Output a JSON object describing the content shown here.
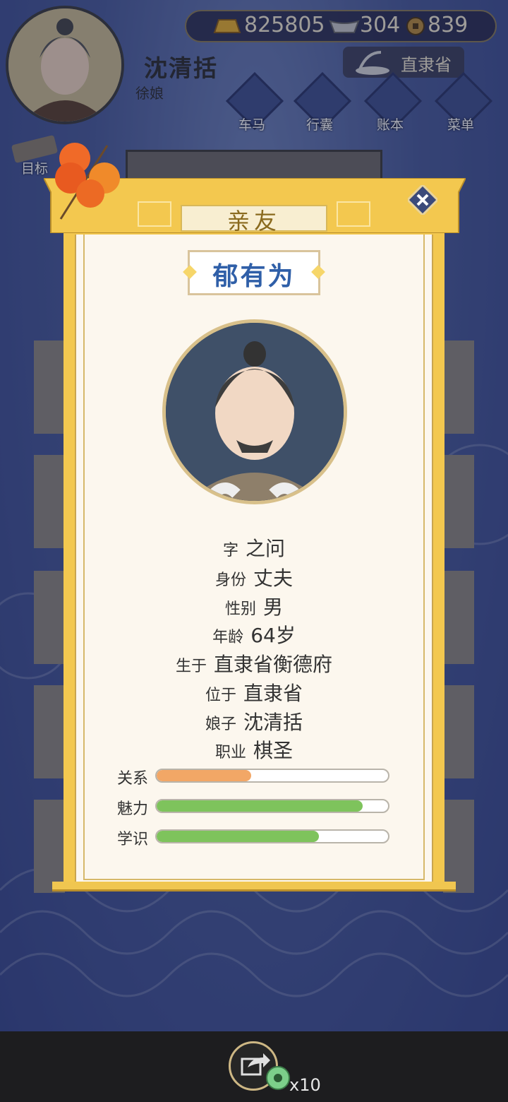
{
  "player": {
    "name": "沈清括",
    "title": "徐娘"
  },
  "resources": {
    "gold": "825805",
    "silver": "304",
    "coins": "839"
  },
  "location": {
    "province": "直隶省"
  },
  "menu": [
    {
      "label": "车马",
      "icon": "carriage-icon"
    },
    {
      "label": "行囊",
      "icon": "bag-icon"
    },
    {
      "label": "账本",
      "icon": "ledger-icon"
    },
    {
      "label": "菜单",
      "icon": "more-icon"
    }
  ],
  "goal": {
    "label": "目标"
  },
  "background_tab": {
    "label": "亲友"
  },
  "modal": {
    "title": "亲友",
    "name": "郁有为",
    "fields": [
      {
        "key": "字",
        "value": "之问"
      },
      {
        "key": "身份",
        "value": "丈夫"
      },
      {
        "key": "性别",
        "value": "男"
      },
      {
        "key": "年龄",
        "value": "64岁"
      },
      {
        "key": "生于",
        "value": "直隶省衡德府"
      },
      {
        "key": "位于",
        "value": "直隶省"
      },
      {
        "key": "娘子",
        "value": "沈清括"
      },
      {
        "key": "职业",
        "value": "棋圣"
      }
    ],
    "stats": [
      {
        "label": "关系",
        "value": 0.41,
        "color": "#f2a766"
      },
      {
        "label": "魅力",
        "value": 0.89,
        "color": "#7ec35c"
      },
      {
        "label": "学识",
        "value": 0.7,
        "color": "#7ec35c"
      }
    ]
  },
  "share": {
    "count": "x10"
  }
}
